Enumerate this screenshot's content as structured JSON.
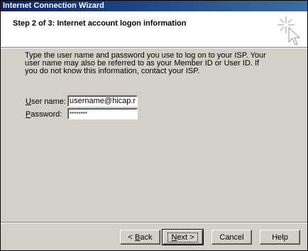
{
  "window": {
    "title": "Internet Connection Wizard"
  },
  "header": {
    "step_title": "Step 2 of 3: Internet account logon information",
    "logo_icon": "wizard-sparkle-cursor-icon"
  },
  "body": {
    "description": "Type the user name and password you use to log on to your ISP. Your user name may also be referred to as your Member ID or User ID. If you do not know this information, contact your ISP.",
    "username": {
      "label_prefix": "U",
      "label_rest": "ser name:",
      "value": "username@hicap.net"
    },
    "password": {
      "label_prefix": "P",
      "label_rest": "assword:",
      "value": "********"
    }
  },
  "buttons": {
    "back": {
      "prefix": "< ",
      "accel": "B",
      "rest": "ack"
    },
    "next": {
      "accel": "N",
      "rest": "ext >"
    },
    "cancel": "Cancel",
    "help": "Help"
  }
}
